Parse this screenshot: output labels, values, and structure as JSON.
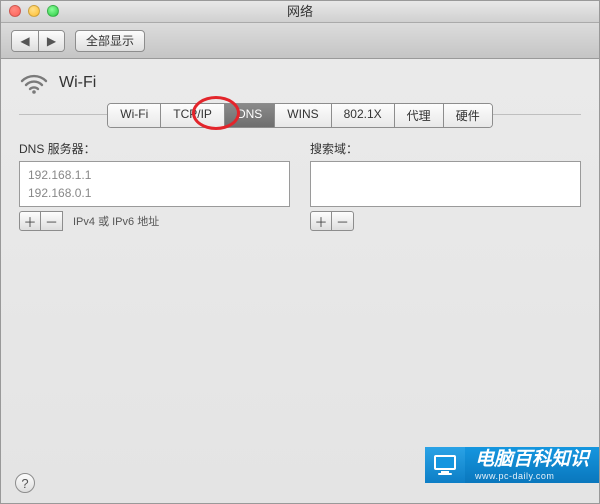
{
  "window": {
    "title": "网络"
  },
  "toolbar": {
    "show_all": "全部显示"
  },
  "service": {
    "name": "Wi-Fi"
  },
  "tabs": [
    {
      "label": "Wi-Fi",
      "active": false
    },
    {
      "label": "TCP/IP",
      "active": false
    },
    {
      "label": "DNS",
      "active": true
    },
    {
      "label": "WINS",
      "active": false
    },
    {
      "label": "802.1X",
      "active": false
    },
    {
      "label": "代理",
      "active": false
    },
    {
      "label": "硬件",
      "active": false
    }
  ],
  "dns": {
    "label": "DNS 服务器：",
    "servers": [
      "192.168.1.1",
      "192.168.0.1"
    ],
    "hint": "IPv4 或 IPv6 地址"
  },
  "search": {
    "label": "搜索域：",
    "domains": []
  },
  "glyphs": {
    "plus": "＋",
    "minus": "－",
    "back": "◀",
    "fwd": "▶",
    "help": "?"
  },
  "watermark": {
    "name": "电脑百科知识",
    "url": "www.pc-daily.com"
  }
}
